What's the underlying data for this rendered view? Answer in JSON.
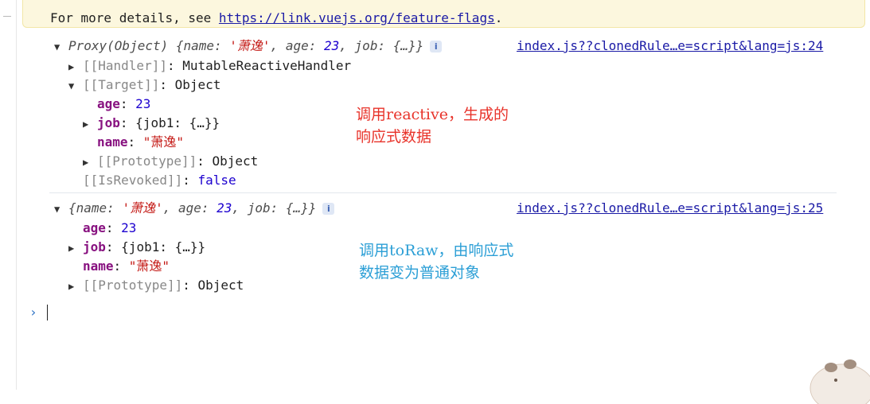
{
  "warning": {
    "prefix": "For more details, see ",
    "link": "https://link.vuejs.org/feature-flags",
    "suffix": "."
  },
  "entry1": {
    "source_link": "index.js??clonedRule…e=script&lang=js:24",
    "summary": {
      "type": "Proxy(Object) {",
      "k1": "name",
      "v1": "'萧逸'",
      "k2": "age",
      "v2": "23",
      "k3": "job",
      "v3": "{…}",
      "close": "}"
    },
    "info_icon": "i",
    "handler": {
      "label": "[[Handler]]",
      "value": "MutableReactiveHandler"
    },
    "target": {
      "label": "[[Target]]",
      "value": "Object"
    },
    "props": [
      {
        "key": "age",
        "value": "23"
      },
      {
        "key": "job",
        "value": "{job1: {…}}"
      },
      {
        "key": "name",
        "value": "\"萧逸\""
      }
    ],
    "prototype": {
      "label": "[[Prototype]]",
      "value": "Object"
    },
    "revoked": {
      "label": "[[IsRevoked]]",
      "value": "false"
    }
  },
  "entry2": {
    "source_link": "index.js??clonedRule…e=script&lang=js:25",
    "summary": {
      "open": "{",
      "k1": "name",
      "v1": "'萧逸'",
      "k2": "age",
      "v2": "23",
      "k3": "job",
      "v3": "{…}",
      "close": "}"
    },
    "info_icon": "i",
    "props": [
      {
        "key": "age",
        "value": "23"
      },
      {
        "key": "job",
        "value": "{job1: {…}}"
      },
      {
        "key": "name",
        "value": "\"萧逸\""
      }
    ],
    "prototype": {
      "label": "[[Prototype]]",
      "value": "Object"
    }
  },
  "annotations": {
    "red": {
      "line1": "调用reactive，生成的",
      "line2": "响应式数据"
    },
    "blue": {
      "line1": "调用toRaw，由响应式",
      "line2": "数据变为普通对象"
    }
  },
  "prompt_glyph": "›",
  "icons": {
    "expand": "triangle-down-icon",
    "collapse": "triangle-right-icon",
    "info": "info-icon",
    "prompt": "chevron-right-icon"
  },
  "colors": {
    "string": "#c41a16",
    "number": "#1c00cf",
    "key": "#881280",
    "link": "#1a1aa6",
    "annotation_red": "#e8332a",
    "annotation_blue": "#2c9fd6",
    "warning_bg": "#fcf7de"
  }
}
